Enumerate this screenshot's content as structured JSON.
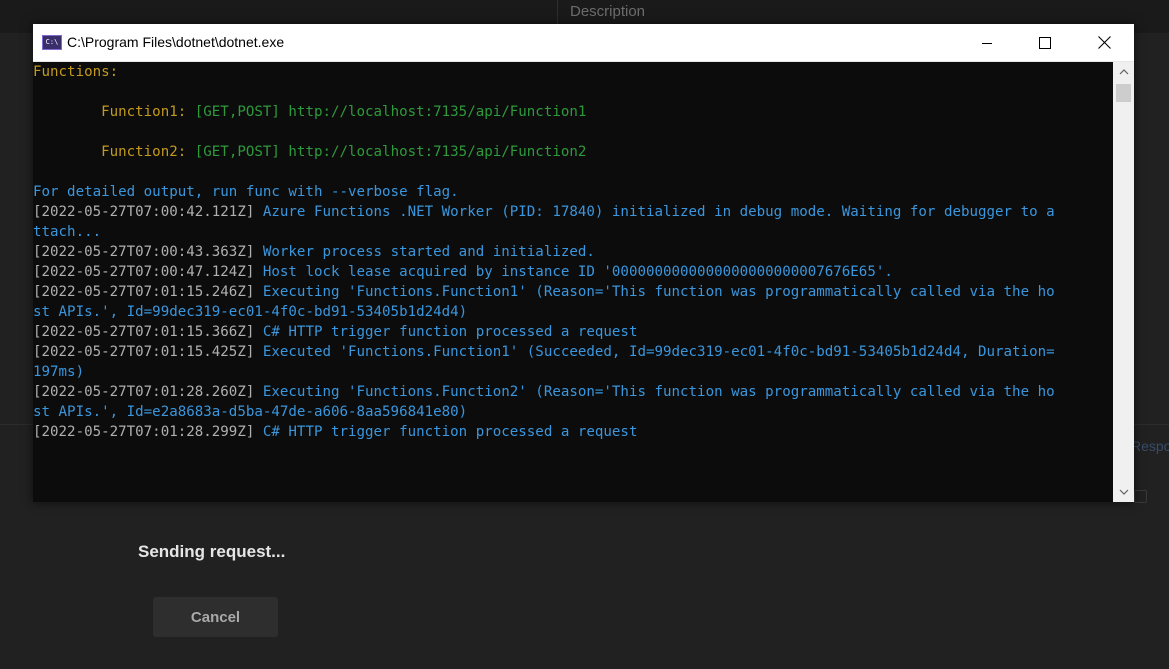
{
  "background": {
    "column_header": "Description",
    "response_fragment": "Respon",
    "status_text": "Sending request...",
    "cancel_label": "Cancel"
  },
  "console": {
    "title": "C:\\Program Files\\dotnet\\dotnet.exe",
    "icon_text": "C:\\",
    "lines": [
      [
        {
          "t": "Functions:",
          "c": "orange"
        }
      ],
      [],
      [
        {
          "t": "        Function1: ",
          "c": "orange"
        },
        {
          "t": "[GET,POST] http://localhost:7135/api/Function1",
          "c": "green"
        }
      ],
      [],
      [
        {
          "t": "        Function2: ",
          "c": "orange"
        },
        {
          "t": "[GET,POST] http://localhost:7135/api/Function2",
          "c": "green"
        }
      ],
      [],
      [
        {
          "t": "For detailed output, run func with --verbose flag.",
          "c": "cyan"
        }
      ],
      [
        {
          "t": "[2022-05-27T07:00:42.121Z] ",
          "c": "gray"
        },
        {
          "t": "Azure Functions .NET Worker (PID: 17840) initialized in debug mode. Waiting for debugger to a",
          "c": "cyan"
        }
      ],
      [
        {
          "t": "ttach...",
          "c": "cyan"
        }
      ],
      [
        {
          "t": "[2022-05-27T07:00:43.363Z] ",
          "c": "gray"
        },
        {
          "t": "Worker process started and initialized.",
          "c": "cyan"
        }
      ],
      [
        {
          "t": "[2022-05-27T07:00:47.124Z] ",
          "c": "gray"
        },
        {
          "t": "Host lock lease acquired by instance ID '0000000000000000000000007676E65'.",
          "c": "cyan"
        }
      ],
      [
        {
          "t": "[2022-05-27T07:01:15.246Z] ",
          "c": "gray"
        },
        {
          "t": "Executing 'Functions.Function1' (Reason='This function was programmatically called via the ho",
          "c": "cyan"
        }
      ],
      [
        {
          "t": "st APIs.', Id=99dec319-ec01-4f0c-bd91-53405b1d24d4)",
          "c": "cyan"
        }
      ],
      [
        {
          "t": "[2022-05-27T07:01:15.366Z] ",
          "c": "gray"
        },
        {
          "t": "C# HTTP trigger function processed a request",
          "c": "cyan"
        }
      ],
      [
        {
          "t": "[2022-05-27T07:01:15.425Z] ",
          "c": "gray"
        },
        {
          "t": "Executed 'Functions.Function1' (Succeeded, Id=99dec319-ec01-4f0c-bd91-53405b1d24d4, Duration=",
          "c": "cyan"
        }
      ],
      [
        {
          "t": "197ms)",
          "c": "cyan"
        }
      ],
      [
        {
          "t": "[2022-05-27T07:01:28.260Z] ",
          "c": "gray"
        },
        {
          "t": "Executing 'Functions.Function2' (Reason='This function was programmatically called via the ho",
          "c": "cyan"
        }
      ],
      [
        {
          "t": "st APIs.', Id=e2a8683a-d5ba-47de-a606-8aa596841e80)",
          "c": "cyan"
        }
      ],
      [
        {
          "t": "[2022-05-27T07:01:28.299Z] ",
          "c": "gray"
        },
        {
          "t": "C# HTTP trigger function processed a request",
          "c": "cyan"
        }
      ]
    ]
  },
  "icons": {
    "minimize": "minimize-icon",
    "maximize": "maximize-icon",
    "close": "close-icon",
    "scroll_up": "chevron-up-icon",
    "scroll_down": "chevron-down-icon"
  },
  "colors": {
    "orange": "#c39a1c",
    "green": "#2e9a3b",
    "cyan": "#3a96dd",
    "gray": "#b0b0b0"
  }
}
